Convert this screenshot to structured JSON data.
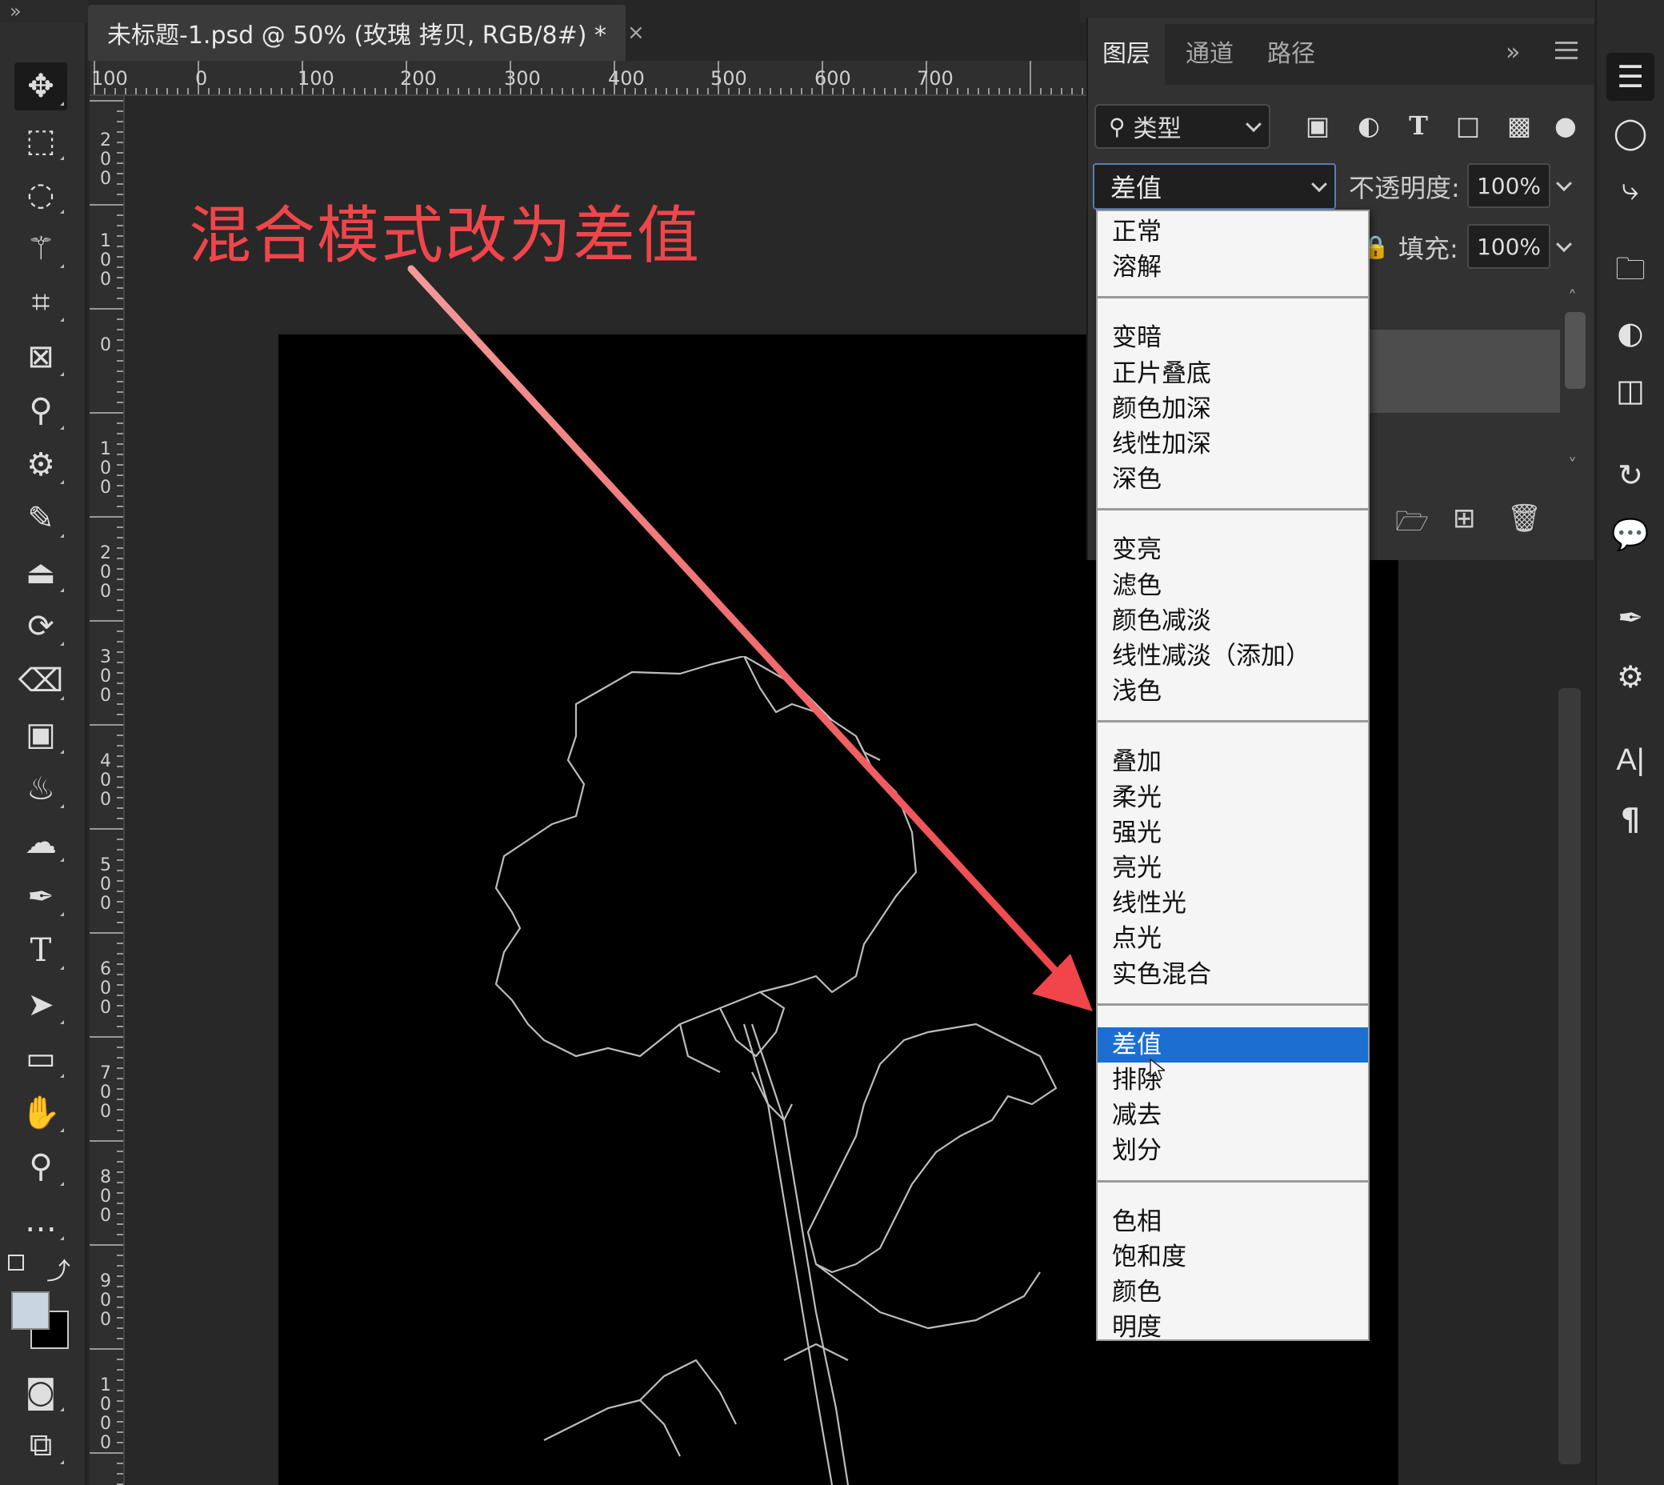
{
  "document": {
    "tab_title": "未标题-1.psd @ 50% (玫瑰 拷贝, RGB/8#) *",
    "close": "×"
  },
  "rulers": {
    "top_labels": [
      "100",
      "0",
      "100",
      "200",
      "300",
      "400",
      "500",
      "600",
      "700"
    ],
    "left_labels": [
      "200",
      "100",
      "0",
      "100",
      "200",
      "300",
      "400",
      "500",
      "600",
      "700",
      "800",
      "900",
      "1000"
    ]
  },
  "annotation": {
    "text": "混合模式改为差值",
    "color": "#f0454a"
  },
  "layers_panel": {
    "tabs": [
      "图层",
      "通道",
      "路径"
    ],
    "collapse": "»",
    "filter": {
      "label": "类型"
    },
    "blend_mode": {
      "value": "差值"
    },
    "opacity": {
      "label": "不透明度:",
      "value": "100%"
    },
    "fill": {
      "label": "填充:",
      "value": "100%"
    }
  },
  "blend_menu": {
    "groups": [
      [
        "正常",
        "溶解"
      ],
      [
        "变暗",
        "正片叠底",
        "颜色加深",
        "线性加深",
        "深色"
      ],
      [
        "变亮",
        "滤色",
        "颜色减淡",
        "线性减淡（添加）",
        "浅色"
      ],
      [
        "叠加",
        "柔光",
        "强光",
        "亮光",
        "线性光",
        "点光",
        "实色混合"
      ],
      [
        "差值",
        "排除",
        "减去",
        "划分"
      ],
      [
        "色相",
        "饱和度",
        "颜色",
        "明度"
      ]
    ],
    "selected": "差值",
    "accent": "#1c6fd0"
  },
  "tools": [
    "move-tool",
    "marquee-tool",
    "lasso-tool",
    "magic-wand-tool",
    "crop-tool",
    "frame-tool",
    "eyedropper-tool",
    "patch-tool",
    "brush-tool",
    "stamp-tool",
    "history-brush-tool",
    "eraser-tool",
    "gradient-tool",
    "blur-tool",
    "dodge-tool",
    "pen-tool",
    "type-tool",
    "path-select-tool",
    "rectangle-tool",
    "hand-tool",
    "zoom-tool",
    "more-tools"
  ],
  "colors": {
    "foreground": "#c8d6e0",
    "background": "#000000"
  },
  "right_strip": {
    "type_label": "A|",
    "paragraph_label": "¶"
  }
}
